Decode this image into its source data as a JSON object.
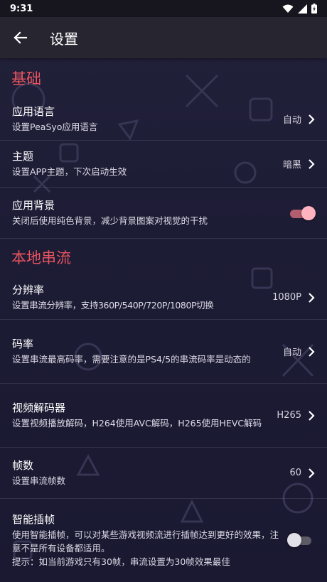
{
  "status_bar": {
    "time": "9:31",
    "icons": [
      "wifi-icon",
      "signal-icon",
      "battery-icon"
    ]
  },
  "app_bar": {
    "back_icon": "arrow-left-icon",
    "title": "设置"
  },
  "colors": {
    "accent": "#e8545f",
    "background": "#1d1c35",
    "app_bar": "#262530",
    "switch_on_thumb": "#ffb3c0"
  },
  "sections": [
    {
      "title": "基础",
      "items": [
        {
          "title": "应用语言",
          "subtitle": "设置PeaSyo应用语言",
          "value": "自动",
          "control": "chevron"
        },
        {
          "title": "主题",
          "subtitle": "设置APP主题，下次启动生效",
          "value": "暗黑",
          "control": "chevron"
        },
        {
          "title": "应用背景",
          "subtitle": "关闭后使用纯色背景，减少背景图案对视觉的干扰",
          "control": "switch",
          "checked": true
        }
      ]
    },
    {
      "title": "本地串流",
      "items": [
        {
          "title": "分辨率",
          "subtitle": "设置串流分辨率，支持360P/540P/720P/1080P切换",
          "value": "1080P",
          "control": "chevron"
        },
        {
          "title": "码率",
          "subtitle": "设置串流最高码率，需要注意的是PS4/5的串流码率是动态的",
          "value": "自动",
          "control": "chevron"
        },
        {
          "title": "视频解码器",
          "subtitle": "设置视频播放解码，H264使用AVC解码，H265使用HEVC解码",
          "value": "H265",
          "control": "chevron"
        },
        {
          "title": "帧数",
          "subtitle": "设置串流帧数",
          "value": "60",
          "control": "chevron"
        },
        {
          "title": "智能插帧",
          "subtitle": "使用智能插帧，可以对某些游戏视频流进行插帧达到更好的效果，注意不是所有设备都适用。",
          "hint": "提示：如当前游戏只有30帧，串流设置为30帧效果最佳",
          "control": "switch",
          "checked": false
        }
      ]
    }
  ]
}
